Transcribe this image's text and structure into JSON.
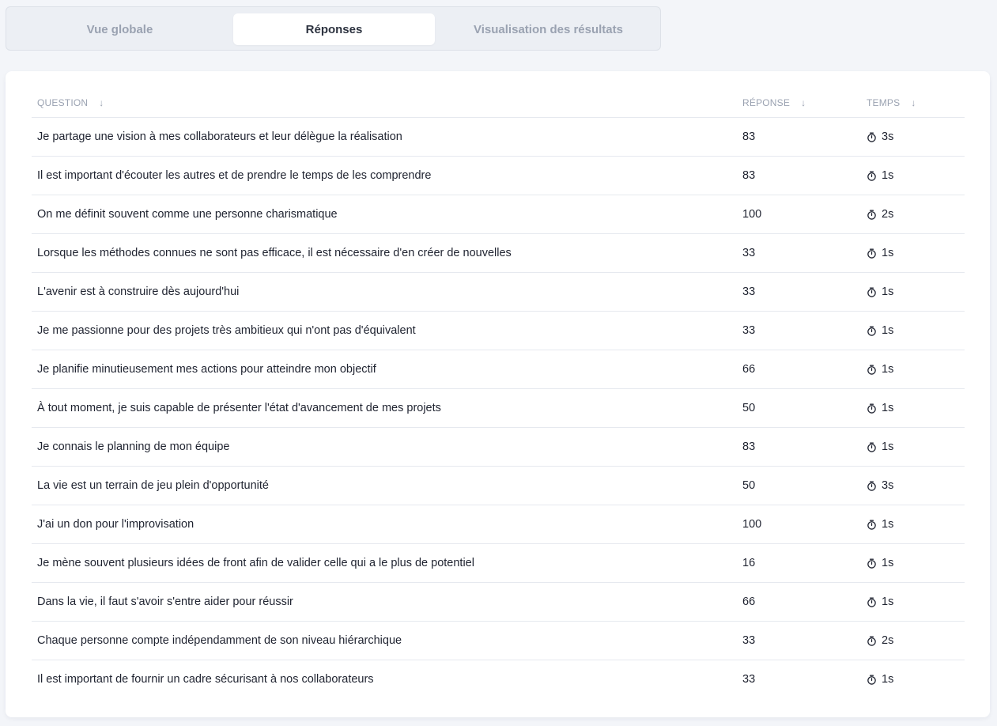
{
  "tabs": [
    {
      "label": "Vue globale",
      "active": false
    },
    {
      "label": "Réponses",
      "active": true
    },
    {
      "label": "Visualisation des résultats",
      "active": false
    }
  ],
  "table": {
    "headers": {
      "question": "QUESTION",
      "reponse": "RÉPONSE",
      "temps": "TEMPS"
    },
    "rows": [
      {
        "question": "Je partage une vision à mes collaborateurs et leur délègue la réalisation",
        "reponse": "83",
        "temps": "3s"
      },
      {
        "question": "Il est important d'écouter les autres et de prendre le temps de les comprendre",
        "reponse": "83",
        "temps": "1s"
      },
      {
        "question": "On me définit souvent comme une personne charismatique",
        "reponse": "100",
        "temps": "2s"
      },
      {
        "question": "Lorsque les méthodes connues ne sont pas efficace, il est nécessaire d'en créer de nouvelles",
        "reponse": "33",
        "temps": "1s"
      },
      {
        "question": "L'avenir est à construire dès aujourd'hui",
        "reponse": "33",
        "temps": "1s"
      },
      {
        "question": "Je me passionne pour des projets très ambitieux qui n'ont pas d'équivalent",
        "reponse": "33",
        "temps": "1s"
      },
      {
        "question": "Je planifie minutieusement mes actions pour atteindre mon objectif",
        "reponse": "66",
        "temps": "1s"
      },
      {
        "question": "À tout moment, je suis capable de présenter l'état d'avancement de mes projets",
        "reponse": "50",
        "temps": "1s"
      },
      {
        "question": "Je connais le planning de mon équipe",
        "reponse": "83",
        "temps": "1s"
      },
      {
        "question": "La vie est un terrain de jeu plein d'opportunité",
        "reponse": "50",
        "temps": "3s"
      },
      {
        "question": "J'ai un don pour l'improvisation",
        "reponse": "100",
        "temps": "1s"
      },
      {
        "question": "Je mène souvent plusieurs idées de front afin de valider celle qui a le plus de potentiel",
        "reponse": "16",
        "temps": "1s"
      },
      {
        "question": "Dans la vie, il faut s'avoir s'entre aider pour réussir",
        "reponse": "66",
        "temps": "1s"
      },
      {
        "question": "Chaque personne compte indépendamment de son niveau hiérarchique",
        "reponse": "33",
        "temps": "2s"
      },
      {
        "question": "Il est important de fournir un cadre sécurisant à nos collaborateurs",
        "reponse": "33",
        "temps": "1s"
      }
    ]
  },
  "icons": {
    "sort": "arrow-down-icon",
    "time": "stopwatch-icon"
  }
}
